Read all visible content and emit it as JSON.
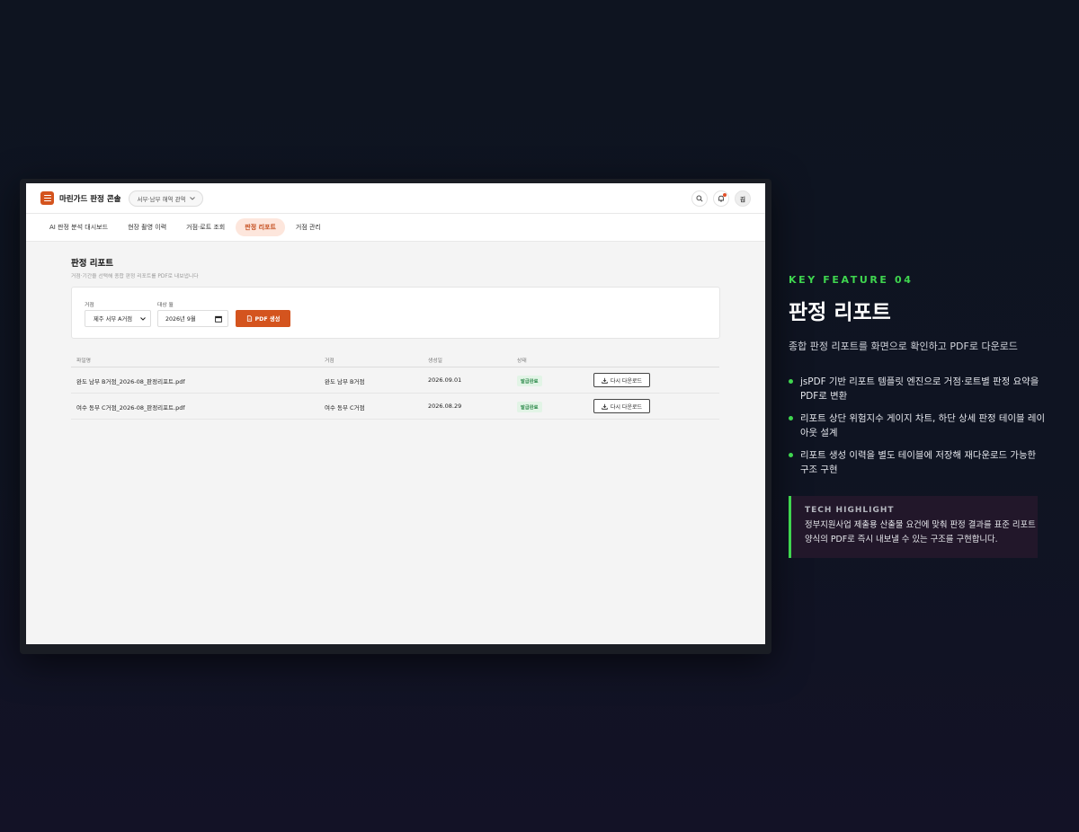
{
  "app": {
    "title": "마린가드 판정 콘솔",
    "region": "서부·남부 해역 관역",
    "avatar": "김"
  },
  "nav": {
    "items": [
      {
        "label": "AI 판정 분석 대시보드"
      },
      {
        "label": "현장 촬영 이력"
      },
      {
        "label": "거점·로트 조회"
      },
      {
        "label": "판정 리포트"
      },
      {
        "label": "거점 관리"
      }
    ],
    "active_index": 3
  },
  "page": {
    "title": "판정 리포트",
    "subtitle": "거점·기간을 선택해 종합 판정 리포트를 PDF로 내보냅니다"
  },
  "filter": {
    "site_label": "거점",
    "site_value": "제주 서부 A거점",
    "month_label": "대상 월",
    "month_value": "2026년 9월",
    "generate_label": "PDF 생성"
  },
  "table": {
    "headers": [
      "파일명",
      "거점",
      "생성일",
      "상태"
    ],
    "rows": [
      {
        "file": "완도 남부 B거점_2026-08_판정리포트.pdf",
        "site": "완도 남부 B거점",
        "date": "2026.09.01",
        "status": "발급완료",
        "action": "다시 다운로드"
      },
      {
        "file": "여수 동부 C거점_2026-08_판정리포트.pdf",
        "site": "여수 동부 C거점",
        "date": "2026.08.29",
        "status": "발급완료",
        "action": "다시 다운로드"
      }
    ]
  },
  "feature": {
    "tag": "KEY FEATURE 04",
    "title": "판정 리포트",
    "description": "종합 판정 리포트를 화면으로 확인하고 PDF로 다운로드",
    "bullets": [
      "jsPDF 기반 리포트 템플릿 엔진으로 거점·로트별 판정 요약을 PDF로 변환",
      "리포트 상단 위험지수 게이지 차트, 하단 상세 판정 테이블 레이아웃 설계",
      "리포트 생성 이력을 별도 테이블에 저장해 재다운로드 가능한 구조 구현"
    ],
    "tech_title": "TECH HIGHLIGHT",
    "tech_body": "정부지원사업 제출용 산출물 요건에 맞춰 판정 결과를 표준 리포트 양식의 PDF로 즉시 내보낼 수 있는 구조를 구현합니다."
  },
  "colors": {
    "accent": "#d4541e",
    "highlight": "#3fd64f",
    "background": "#0e1420"
  }
}
